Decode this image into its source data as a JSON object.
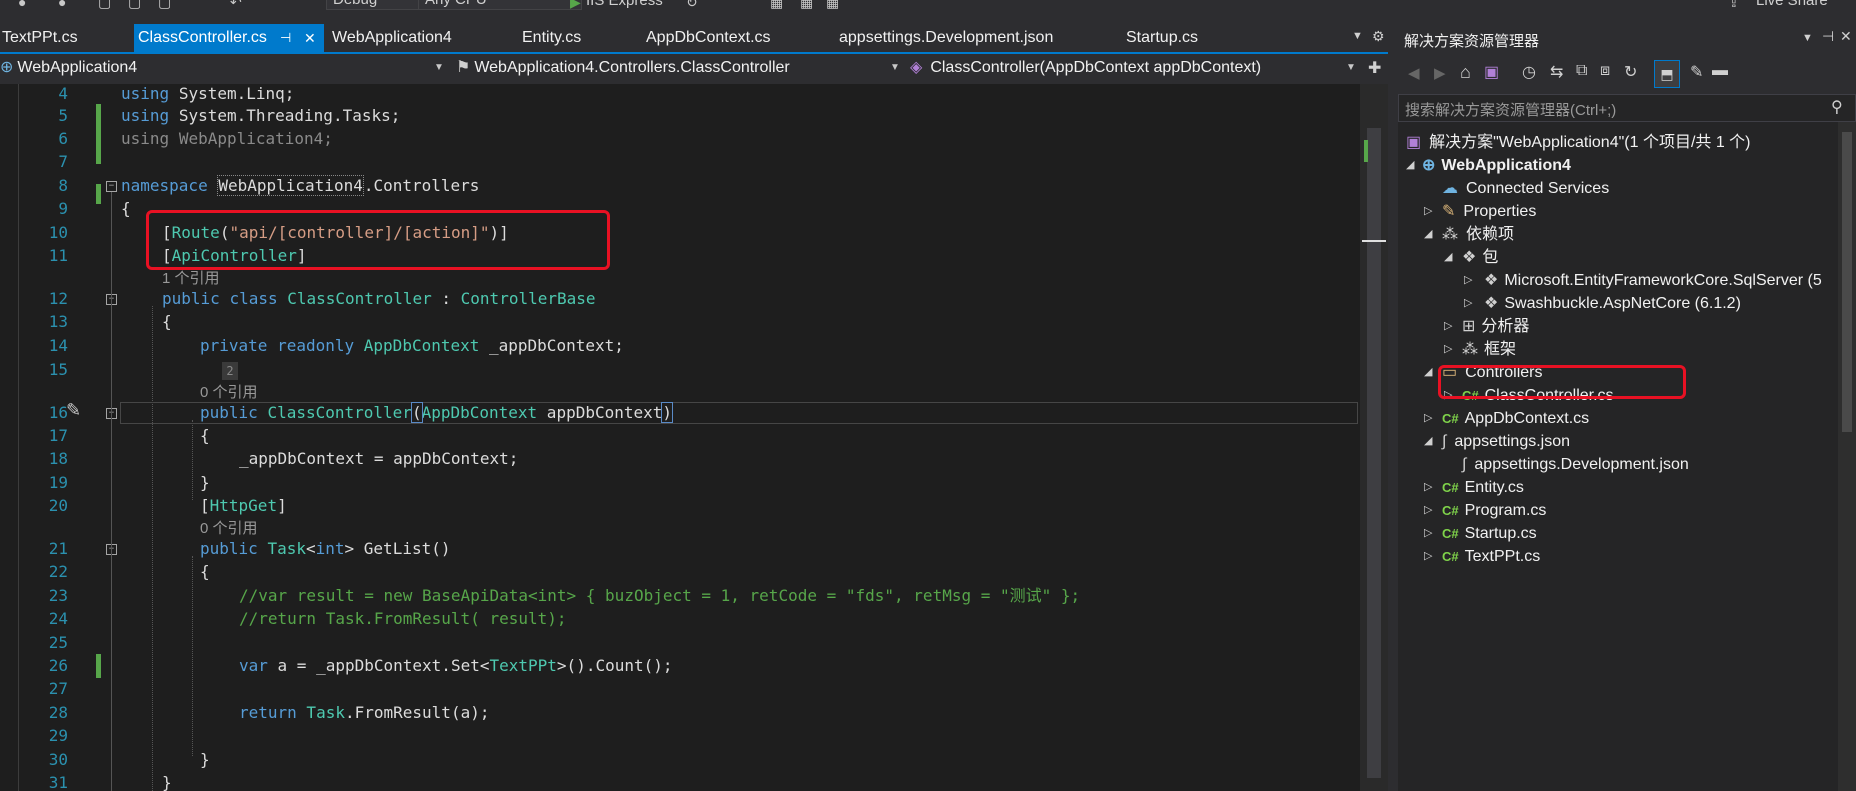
{
  "toolbar": {
    "config": "Debug",
    "platform": "Any CPU",
    "run_target": "IIS Express",
    "live_share": "Live Share"
  },
  "tabs": [
    {
      "label": "TextPPt.cs"
    },
    {
      "label": "ClassController.cs",
      "pin": "⊣",
      "close": "✕"
    },
    {
      "label": "WebApplication4"
    },
    {
      "label": "Entity.cs"
    },
    {
      "label": "AppDbContext.cs"
    },
    {
      "label": "appsettings.Development.json"
    },
    {
      "label": "Startup.cs"
    }
  ],
  "navbar": {
    "project": "WebApplication4",
    "class": "WebApplication4.Controllers.ClassController",
    "member": "ClassController(AppDbContext appDbContext)"
  },
  "lines": {
    "l4": {
      "n": "4",
      "using": "using",
      "ns": "System.Linq;"
    },
    "l5": {
      "n": "5",
      "using": "using",
      "ns": "System.Threading.Tasks;"
    },
    "l6": {
      "n": "6",
      "using": "using",
      "ns": "WebApplication4;"
    },
    "l7": {
      "n": "7"
    },
    "l8": {
      "n": "8",
      "kw": "namespace",
      "ns1": "WebApplication4",
      "ns2": ".Controllers"
    },
    "l9": {
      "n": "9",
      "text": "{"
    },
    "l10": {
      "n": "10",
      "open": "[",
      "attr": "Route",
      "p1": "(",
      "str": "\"api/[controller]/[action]\"",
      "p2": ")]"
    },
    "l11": {
      "n": "11",
      "open": "[",
      "attr": "ApiController",
      "close": "]"
    },
    "lens1": "1 个引用",
    "l12": {
      "n": "12",
      "kw1": "public",
      "kw2": "class",
      "name": "ClassController",
      "colon": " : ",
      "base": "ControllerBase"
    },
    "l13": {
      "n": "13",
      "text": "{"
    },
    "l14": {
      "n": "14",
      "kw1": "private",
      "kw2": "readonly",
      "type": "AppDbContext",
      "field": " _appDbContext;"
    },
    "l15": {
      "n": "15",
      "hint": "2"
    },
    "lens2": "0 个引用",
    "l16": {
      "n": "16",
      "kw": "public",
      "name": "ClassController",
      "p1": "(",
      "type": "AppDbContext",
      "param": " appDbContext",
      "p2": ")"
    },
    "l17": {
      "n": "17",
      "text": "{"
    },
    "l18": {
      "n": "18",
      "text": "_appDbContext = appDbContext;"
    },
    "l19": {
      "n": "19",
      "text": "}"
    },
    "l20": {
      "n": "20",
      "open": "[",
      "attr": "HttpGet",
      "close": "]"
    },
    "lens3": "0 个引用",
    "l21": {
      "n": "21",
      "kw": "public",
      "type": "Task",
      "lt": "<",
      "gtype": "int",
      "gt": ">",
      "rest": " GetList()"
    },
    "l22": {
      "n": "22",
      "text": "{"
    },
    "l23": {
      "n": "23",
      "text": "//var result = new BaseApiData<int> { buzObject = 1, retCode = \"fds\", retMsg = \"测试\" };"
    },
    "l24": {
      "n": "24",
      "text": "//return Task.FromResult( result);"
    },
    "l25": {
      "n": "25"
    },
    "l26": {
      "n": "26",
      "kw": "var",
      "a": " a = _appDbContext.",
      "m1": "Set",
      "lt": "<",
      "type": "TextPPt",
      "gt": ">().",
      "m2": "Count",
      "end": "();"
    },
    "l27": {
      "n": "27"
    },
    "l28": {
      "n": "28",
      "kw": "return",
      "type": " Task",
      "dot": ".",
      "m": "FromResult",
      "end": "(a);"
    },
    "l29": {
      "n": "29"
    },
    "l30": {
      "n": "30",
      "text": "}"
    },
    "l31": {
      "n": "31",
      "text": "}"
    }
  },
  "solution_explorer": {
    "title": "解决方案资源管理器",
    "search_placeholder": "搜索解决方案资源管理器(Ctrl+;)",
    "nodes": [
      {
        "label": "解决方案\"WebApplication4\"(1 个项目/共 1 个)"
      },
      {
        "label": "WebApplication4"
      },
      {
        "label": "Connected Services"
      },
      {
        "label": "Properties"
      },
      {
        "label": "依赖项"
      },
      {
        "label": "包"
      },
      {
        "label": "Microsoft.EntityFrameworkCore.SqlServer (5"
      },
      {
        "label": "Swashbuckle.AspNetCore (6.1.2)"
      },
      {
        "label": "分析器"
      },
      {
        "label": "框架"
      },
      {
        "label": "Controllers"
      },
      {
        "label": "ClassController.cs"
      },
      {
        "label": "AppDbContext.cs"
      },
      {
        "label": "appsettings.json"
      },
      {
        "label": "appsettings.Development.json"
      },
      {
        "label": "Entity.cs"
      },
      {
        "label": "Program.cs"
      },
      {
        "label": "Startup.cs"
      },
      {
        "label": "TextPPt.cs"
      }
    ]
  },
  "colors": {
    "accent": "#007acc",
    "highlight_box": "#e81123",
    "keyword": "#569cd6",
    "type": "#4ec9b0",
    "string": "#d69d85",
    "comment": "#57a64a"
  }
}
